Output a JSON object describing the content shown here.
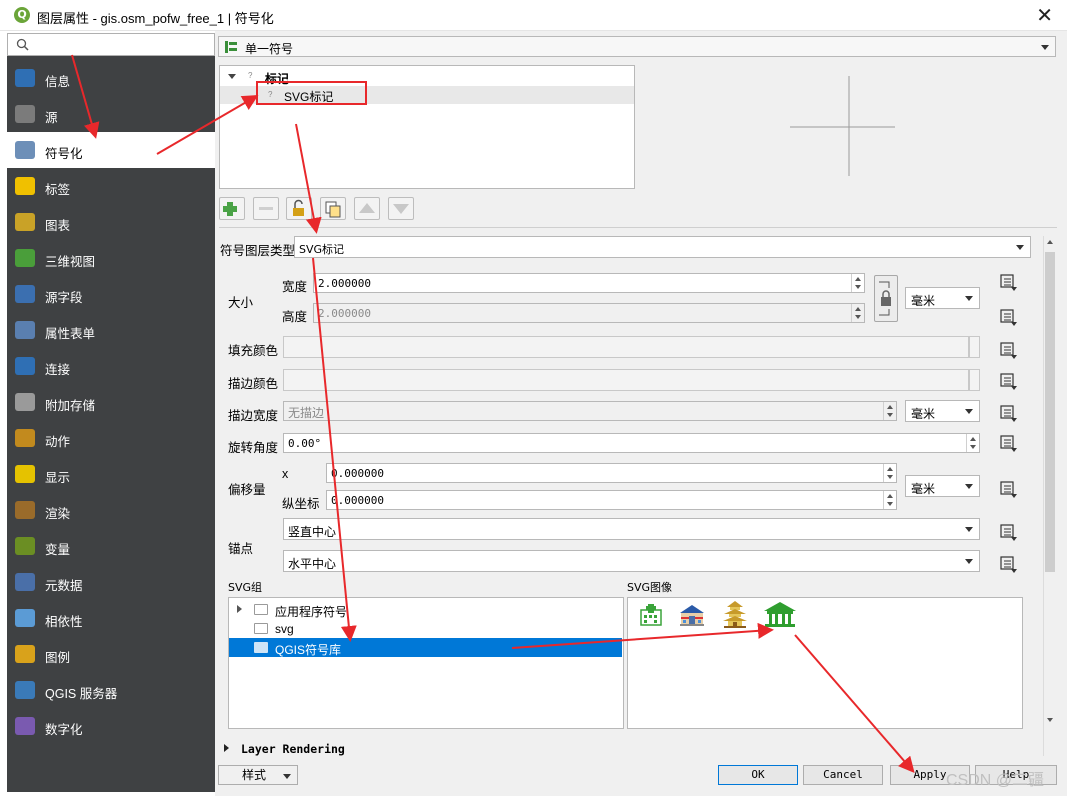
{
  "window": {
    "title": "图层属性 - gis.osm_pofw_free_1 | 符号化",
    "close_glyph": "✕"
  },
  "sidebar": {
    "search_placeholder": "",
    "items": [
      {
        "label": "信息",
        "icon": "info-icon"
      },
      {
        "label": "源",
        "icon": "source-icon"
      },
      {
        "label": "符号化",
        "icon": "symbology-icon",
        "active": true
      },
      {
        "label": "标签",
        "icon": "labels-icon"
      },
      {
        "label": "图表",
        "icon": "diagrams-icon"
      },
      {
        "label": "三维视图",
        "icon": "3d-view-icon"
      },
      {
        "label": "源字段",
        "icon": "fields-icon"
      },
      {
        "label": "属性表单",
        "icon": "attributes-form-icon"
      },
      {
        "label": "连接",
        "icon": "joins-icon"
      },
      {
        "label": "附加存储",
        "icon": "auxiliary-storage-icon"
      },
      {
        "label": "动作",
        "icon": "actions-icon"
      },
      {
        "label": "显示",
        "icon": "display-icon"
      },
      {
        "label": "渲染",
        "icon": "rendering-icon"
      },
      {
        "label": "变量",
        "icon": "variables-icon"
      },
      {
        "label": "元数据",
        "icon": "metadata-icon"
      },
      {
        "label": "相依性",
        "icon": "dependencies-icon"
      },
      {
        "label": "图例",
        "icon": "legend-icon"
      },
      {
        "label": "QGIS 服务器",
        "icon": "qgis-server-icon"
      },
      {
        "label": "数字化",
        "icon": "digitizing-icon"
      }
    ]
  },
  "renderer": {
    "value": "单一符号"
  },
  "symbol_tree": {
    "root": "标记",
    "child": "SVG标记"
  },
  "symbol_layer": {
    "type_label": "符号图层类型",
    "type_value": "SVG标记",
    "size_label": "大小",
    "width_label": "宽度",
    "width_value": "2.000000",
    "height_label": "高度",
    "height_value": "2.000000",
    "size_unit": "毫米",
    "fill_color_label": "填充颜色",
    "stroke_color_label": "描边颜色",
    "stroke_width_label": "描边宽度",
    "stroke_width_value": "无描边",
    "stroke_width_unit": "毫米",
    "rotation_label": "旋转角度",
    "rotation_value": "0.00°",
    "offset_label": "偏移量",
    "offset_x_label": "x",
    "offset_x_value": "0.000000",
    "offset_y_label": "纵坐标",
    "offset_y_value": "0.000000",
    "offset_unit": "毫米",
    "anchor_label": "锚点",
    "anchor_v": "竖直中心",
    "anchor_h": "水平中心"
  },
  "svg_groups": {
    "label": "SVG组",
    "items": [
      {
        "label": "应用程序符号",
        "expandable": true
      },
      {
        "label": "svg",
        "expandable": false
      },
      {
        "label": "QGIS符号库",
        "selected": true
      }
    ]
  },
  "svg_images": {
    "label": "SVG图像",
    "icons": [
      "hospital-icon",
      "school-icon",
      "pagoda-icon",
      "temple-icon"
    ]
  },
  "layer_rendering": "Layer Rendering",
  "footer": {
    "style_label": "样式",
    "ok": "OK",
    "cancel": "Cancel",
    "apply": "Apply",
    "help": "Help"
  },
  "watermark": "CSDN @二疆",
  "colors": {
    "sidebar_bg": "#3f4143",
    "selection": "#0078d7",
    "annotation_red": "#e8282b"
  }
}
